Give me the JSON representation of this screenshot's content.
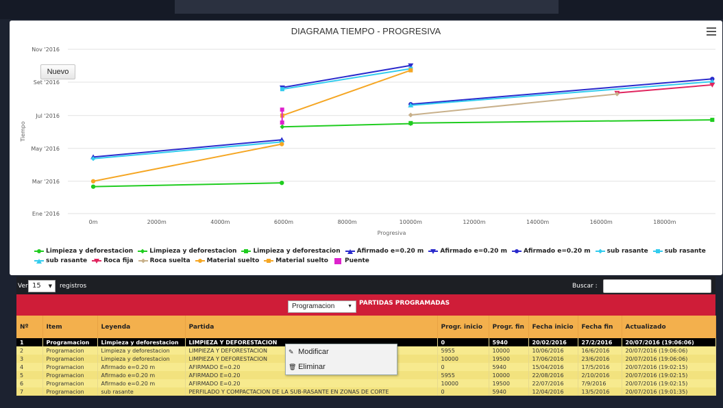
{
  "chart": {
    "title": "DIAGRAMA TIEMPO - PROGRESIVA",
    "nuevo_label": "Nuevo",
    "menu_icon": "hamburger-menu-icon"
  },
  "chart_data": {
    "type": "line",
    "title": "DIAGRAMA TIEMPO - PROGRESIVA",
    "xlabel": "Progresiva",
    "ylabel": "Tiempo",
    "xlim": [
      -800,
      19600
    ],
    "ylim": [
      "2016-01-01",
      "2016-11-01"
    ],
    "x_ticks": [
      "0m",
      "2000m",
      "4000m",
      "6000m",
      "8000m",
      "10000m",
      "12000m",
      "14000m",
      "16000m",
      "18000m"
    ],
    "y_ticks": [
      "Ene '2016",
      "Mar '2016",
      "May '2016",
      "Jul '2016",
      "Set '2016",
      "Nov '2016"
    ],
    "grid": "horizontal",
    "legend_position": "bottom",
    "series": [
      {
        "name": "Limpieza y deforestacion",
        "color": "#1fcc1f",
        "marker": "circle",
        "points": [
          [
            0,
            "2016-02-20"
          ],
          [
            5940,
            "2016-02-27"
          ]
        ]
      },
      {
        "name": "Limpieza y deforestacion",
        "color": "#1fcc1f",
        "marker": "diamond",
        "points": [
          [
            5955,
            "2016-06-10"
          ],
          [
            10000,
            "2016-06-16"
          ]
        ]
      },
      {
        "name": "Limpieza y deforestacion",
        "color": "#1fcc1f",
        "marker": "square",
        "points": [
          [
            10000,
            "2016-06-17"
          ],
          [
            19500,
            "2016-06-23"
          ]
        ]
      },
      {
        "name": "Afirmado e=0.20 m",
        "color": "#2a2acc",
        "marker": "triangle",
        "points": [
          [
            0,
            "2016-04-15"
          ],
          [
            5940,
            "2016-05-17"
          ]
        ]
      },
      {
        "name": "Afirmado e=0.20 m",
        "color": "#2a2acc",
        "marker": "triangle-down",
        "points": [
          [
            5955,
            "2016-08-22"
          ],
          [
            10000,
            "2016-10-02"
          ]
        ]
      },
      {
        "name": "Afirmado e=0.20 m",
        "color": "#2a2acc",
        "marker": "circle",
        "points": [
          [
            10000,
            "2016-07-22"
          ],
          [
            19500,
            "2016-09-07"
          ]
        ]
      },
      {
        "name": "sub rasante",
        "color": "#33ccee",
        "marker": "diamond",
        "points": [
          [
            0,
            "2016-04-12"
          ],
          [
            5940,
            "2016-05-13"
          ]
        ]
      },
      {
        "name": "sub rasante",
        "color": "#33ccee",
        "marker": "square",
        "points": [
          [
            5955,
            "2016-08-19"
          ],
          [
            10000,
            "2016-09-26"
          ]
        ]
      },
      {
        "name": "sub rasante",
        "color": "#33ccee",
        "marker": "triangle",
        "points": [
          [
            10000,
            "2016-07-20"
          ],
          [
            19500,
            "2016-09-02"
          ]
        ]
      },
      {
        "name": "Roca fija",
        "color": "#e0245e",
        "marker": "triangle-down",
        "points": [
          [
            16500,
            "2016-08-12"
          ],
          [
            19500,
            "2016-08-27"
          ]
        ]
      },
      {
        "name": "Roca suelta",
        "color": "#c8b08a",
        "marker": "diamond",
        "points": [
          [
            10000,
            "2016-07-02"
          ],
          [
            16500,
            "2016-08-10"
          ]
        ]
      },
      {
        "name": "Material suelto",
        "color": "#f5a623",
        "marker": "circle",
        "points": [
          [
            0,
            "2016-03-01"
          ],
          [
            5940,
            "2016-05-09"
          ]
        ]
      },
      {
        "name": "Material suelto",
        "color": "#f5a623",
        "marker": "square",
        "points": [
          [
            5955,
            "2016-07-01"
          ],
          [
            10000,
            "2016-09-23"
          ]
        ]
      },
      {
        "name": "Puente",
        "color": "#dd22cc",
        "marker": "square",
        "points": [
          [
            5950,
            "2016-06-18"
          ],
          [
            5950,
            "2016-07-12"
          ]
        ]
      }
    ]
  },
  "table": {
    "length_label": "Ver",
    "length_value": "15",
    "length_suffix": "registros",
    "search_label": "Buscar :",
    "search_value": "",
    "filter_value": "Programacion",
    "section_title": "PARTIDAS PROGRAMADAS",
    "headers": [
      "Nº",
      "Item",
      "Leyenda",
      "Partida",
      "Progr. inicio",
      "Progr. fin",
      "Fecha inicio",
      "Fecha fin",
      "Actualizado"
    ],
    "rows": [
      [
        "1",
        "Programacion",
        "Limpieza y deforestacion",
        "LIMPIEZA Y DEFORESTACION",
        "0",
        "5940",
        "20/02/2016",
        "27/2/2016",
        "20/07/2016 (19:06:06)"
      ],
      [
        "2",
        "Programacion",
        "Limpieza y deforestacion",
        "LIMPIEZA Y DEFORESTACION",
        "5955",
        "10000",
        "10/06/2016",
        "16/6/2016",
        "20/07/2016 (19:06:06)"
      ],
      [
        "3",
        "Programacion",
        "Limpieza y deforestacion",
        "LIMPIEZA Y DEFORESTACION",
        "10000",
        "19500",
        "17/06/2016",
        "23/6/2016",
        "20/07/2016 (19:06:06)"
      ],
      [
        "4",
        "Programacion",
        "Afirmado e=0.20 m",
        "AFIRMADO E=0.20",
        "0",
        "5940",
        "15/04/2016",
        "17/5/2016",
        "20/07/2016 (19:02:15)"
      ],
      [
        "5",
        "Programacion",
        "Afirmado e=0.20 m",
        "AFIRMADO E=0.20",
        "5955",
        "10000",
        "22/08/2016",
        "2/10/2016",
        "20/07/2016 (19:02:15)"
      ],
      [
        "6",
        "Programacion",
        "Afirmado e=0.20 m",
        "AFIRMADO E=0.20",
        "10000",
        "19500",
        "22/07/2016",
        "7/9/2016",
        "20/07/2016 (19:02:15)"
      ],
      [
        "7",
        "Programacion",
        "sub rasante",
        "PERFILADO Y COMPACTACION DE LA SUB-RASANTE EN ZONAS DE CORTE",
        "0",
        "5940",
        "12/04/2016",
        "13/5/2016",
        "20/07/2016 (19:01:35)"
      ]
    ],
    "selected_row": 1
  },
  "context_menu": {
    "items": [
      {
        "label": "Modificar",
        "icon": "edit-icon"
      },
      {
        "label": "Eliminar",
        "icon": "trash-icon"
      }
    ]
  }
}
